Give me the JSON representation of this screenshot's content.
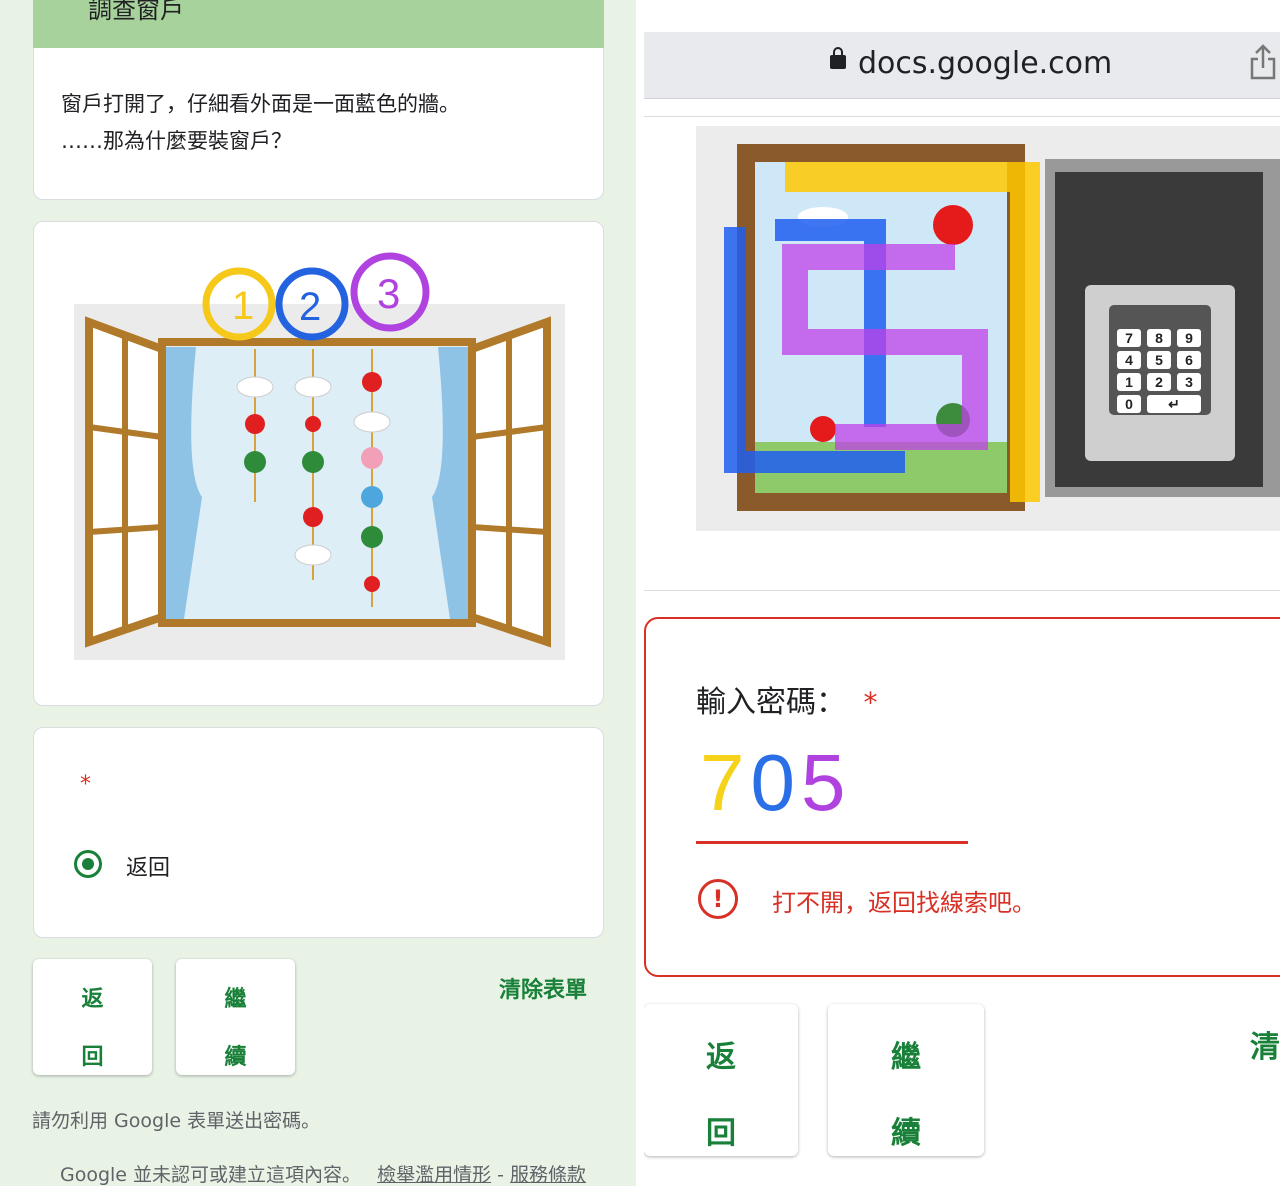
{
  "left": {
    "title": "調查窗戶",
    "description_line1": "窗戶打開了，仔細看外面是一面藍色的牆。",
    "description_line2": "……那為什麼要裝窗戶？",
    "image_labels": [
      "1",
      "2",
      "3"
    ],
    "question_required_mark": "*",
    "radio_option": "返回",
    "back_button": [
      "返",
      "回"
    ],
    "continue_button": [
      "繼",
      "續"
    ],
    "clear_form": "清除表單",
    "notice": "請勿利用 Google 表單送出密碼。",
    "footer_text": "Google 並未認可或建立這項內容。",
    "footer_report": "檢舉濫用情形",
    "footer_sep": " - ",
    "footer_terms": "服務條款"
  },
  "right": {
    "url": "docs.google.com",
    "keypad_keys": [
      "7",
      "8",
      "9",
      "4",
      "5",
      "6",
      "1",
      "2",
      "3",
      "0",
      "↵"
    ],
    "field_label": "輸入密碼：",
    "required_mark": "*",
    "input_value": "705",
    "error_text": "打不開，返回找線索吧。",
    "back_button": [
      "返",
      "回"
    ],
    "continue_button": [
      "繼",
      "續"
    ],
    "clear_partial": "清"
  },
  "colors": {
    "accent_green": "#188038",
    "header_green": "#a8d29b",
    "error_red": "#d93025",
    "bg_green": "#e8f3e6"
  }
}
